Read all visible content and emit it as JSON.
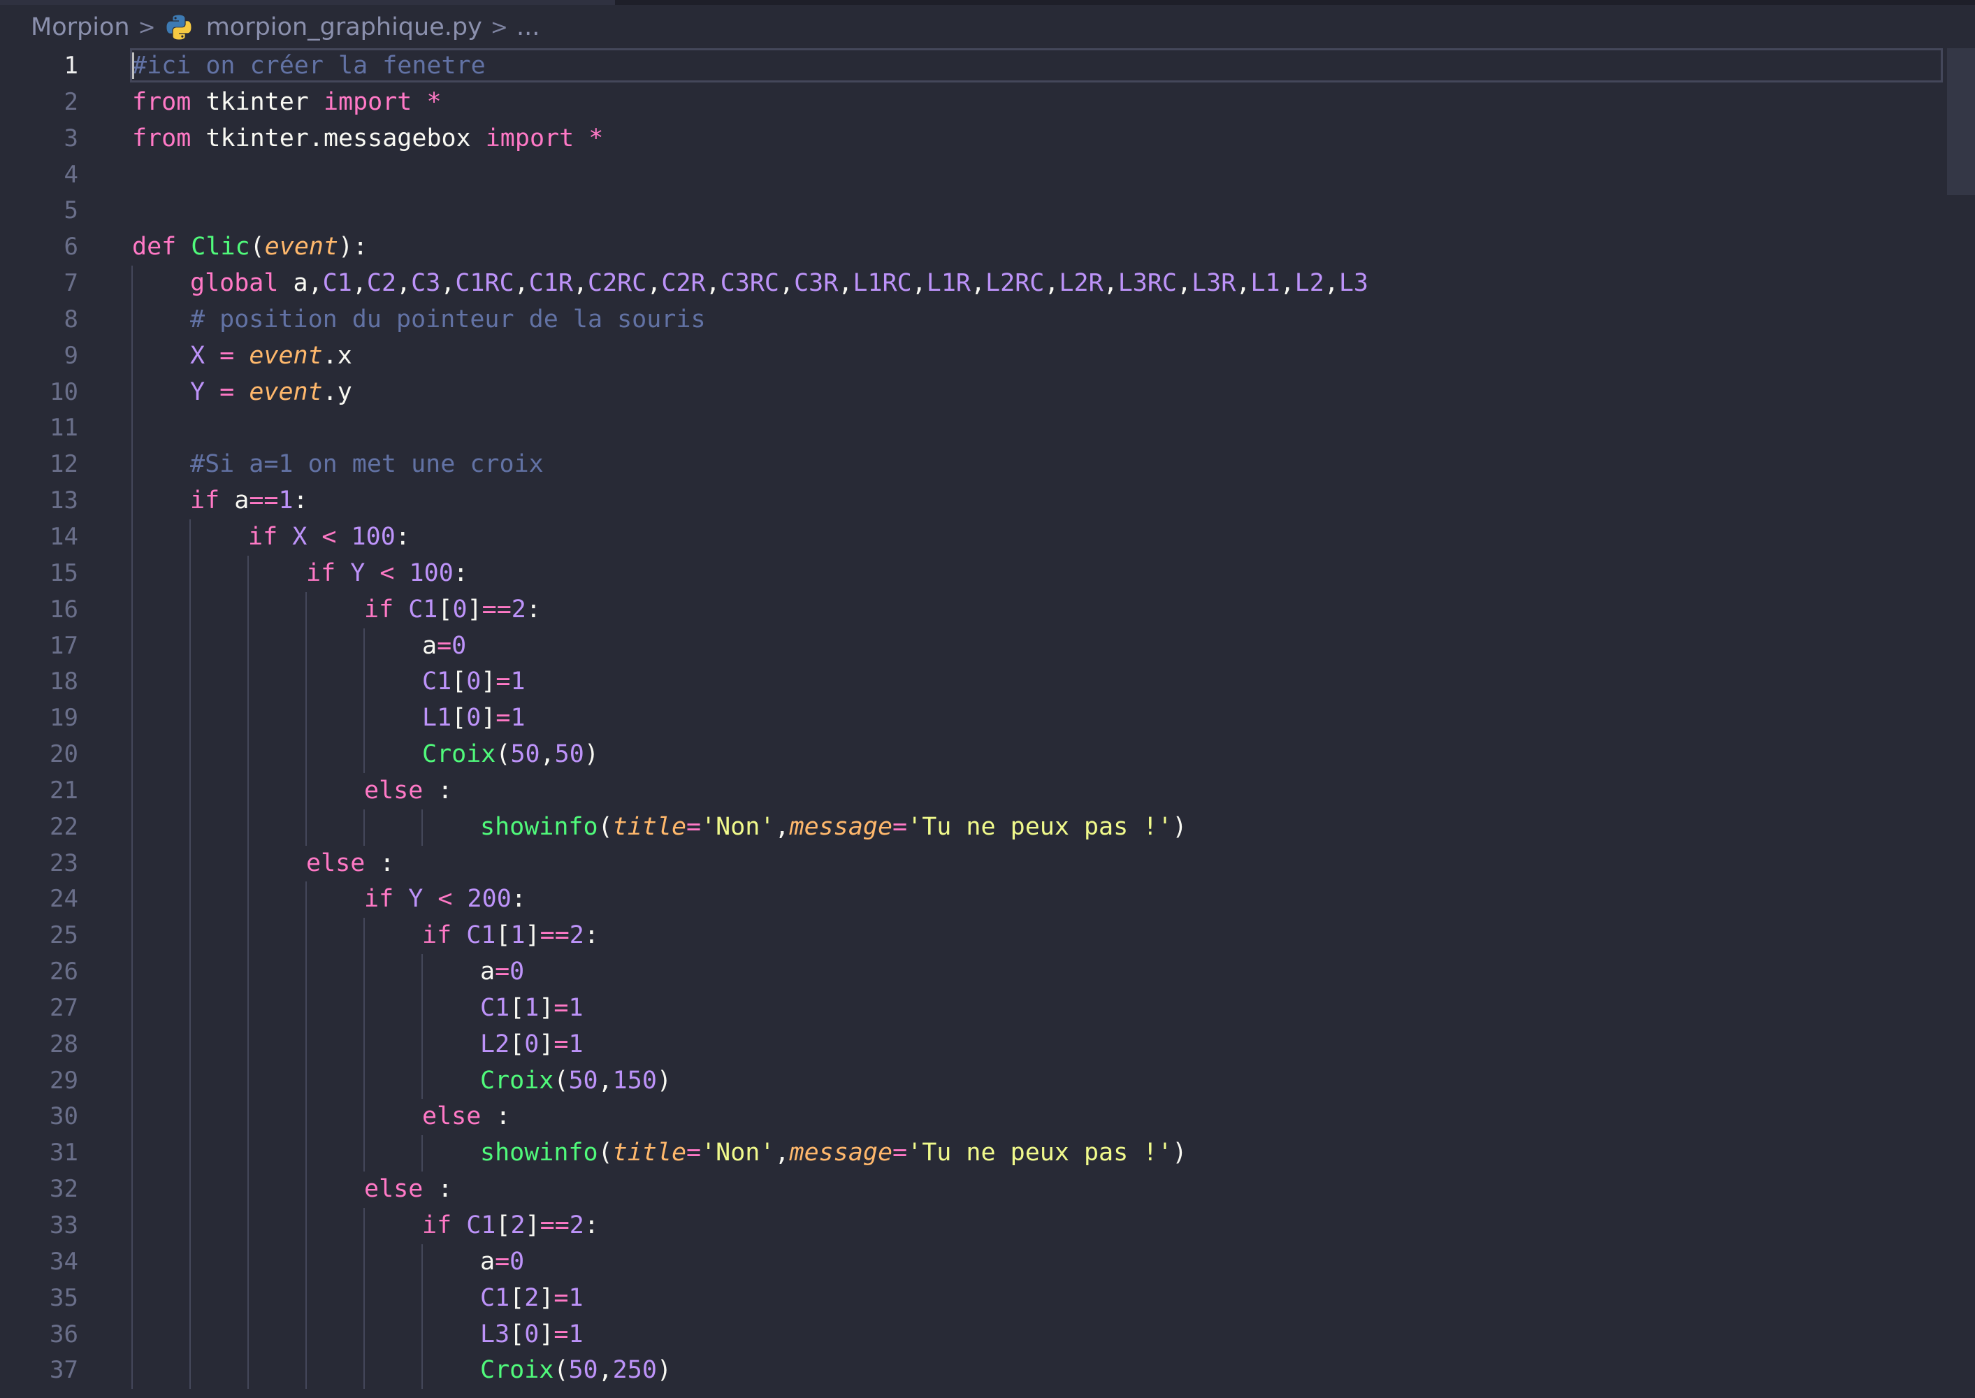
{
  "breadcrumb": {
    "folder": "Morpion",
    "separator": ">",
    "file": "morpion_graphique.py",
    "ellipsis": "...",
    "file_icon": "python-icon"
  },
  "editor": {
    "current_line": 1,
    "lines": [
      {
        "n": "1",
        "indent": 0,
        "tokens": [
          {
            "t": "#ici on créer la fenetre",
            "c": "cm"
          }
        ]
      },
      {
        "n": "2",
        "indent": 0,
        "tokens": [
          {
            "t": "from",
            "c": "kw"
          },
          {
            "t": " tkinter ",
            "c": "plain"
          },
          {
            "t": "import",
            "c": "kw"
          },
          {
            "t": " ",
            "c": "plain"
          },
          {
            "t": "*",
            "c": "op"
          }
        ]
      },
      {
        "n": "3",
        "indent": 0,
        "tokens": [
          {
            "t": "from",
            "c": "kw"
          },
          {
            "t": " tkinter.messagebox ",
            "c": "plain"
          },
          {
            "t": "import",
            "c": "kw"
          },
          {
            "t": " ",
            "c": "plain"
          },
          {
            "t": "*",
            "c": "op"
          }
        ]
      },
      {
        "n": "4",
        "indent": 0,
        "tokens": []
      },
      {
        "n": "5",
        "indent": 0,
        "tokens": []
      },
      {
        "n": "6",
        "indent": 0,
        "tokens": [
          {
            "t": "def",
            "c": "kw"
          },
          {
            "t": " ",
            "c": "plain"
          },
          {
            "t": "Clic",
            "c": "fn"
          },
          {
            "t": "(",
            "c": "plain"
          },
          {
            "t": "event",
            "c": "param"
          },
          {
            "t": "):",
            "c": "plain"
          }
        ]
      },
      {
        "n": "7",
        "indent": 1,
        "tokens": [
          {
            "t": "global",
            "c": "kw"
          },
          {
            "t": " a,",
            "c": "plain"
          },
          {
            "t": "C1",
            "c": "const"
          },
          {
            "t": ",",
            "c": "plain"
          },
          {
            "t": "C2",
            "c": "const"
          },
          {
            "t": ",",
            "c": "plain"
          },
          {
            "t": "C3",
            "c": "const"
          },
          {
            "t": ",",
            "c": "plain"
          },
          {
            "t": "C1RC",
            "c": "const"
          },
          {
            "t": ",",
            "c": "plain"
          },
          {
            "t": "C1R",
            "c": "const"
          },
          {
            "t": ",",
            "c": "plain"
          },
          {
            "t": "C2RC",
            "c": "const"
          },
          {
            "t": ",",
            "c": "plain"
          },
          {
            "t": "C2R",
            "c": "const"
          },
          {
            "t": ",",
            "c": "plain"
          },
          {
            "t": "C3RC",
            "c": "const"
          },
          {
            "t": ",",
            "c": "plain"
          },
          {
            "t": "C3R",
            "c": "const"
          },
          {
            "t": ",",
            "c": "plain"
          },
          {
            "t": "L1RC",
            "c": "const"
          },
          {
            "t": ",",
            "c": "plain"
          },
          {
            "t": "L1R",
            "c": "const"
          },
          {
            "t": ",",
            "c": "plain"
          },
          {
            "t": "L2RC",
            "c": "const"
          },
          {
            "t": ",",
            "c": "plain"
          },
          {
            "t": "L2R",
            "c": "const"
          },
          {
            "t": ",",
            "c": "plain"
          },
          {
            "t": "L3RC",
            "c": "const"
          },
          {
            "t": ",",
            "c": "plain"
          },
          {
            "t": "L3R",
            "c": "const"
          },
          {
            "t": ",",
            "c": "plain"
          },
          {
            "t": "L1",
            "c": "const"
          },
          {
            "t": ",",
            "c": "plain"
          },
          {
            "t": "L2",
            "c": "const"
          },
          {
            "t": ",",
            "c": "plain"
          },
          {
            "t": "L3",
            "c": "const"
          }
        ]
      },
      {
        "n": "8",
        "indent": 1,
        "tokens": [
          {
            "t": "# position du pointeur de la souris",
            "c": "cm"
          }
        ]
      },
      {
        "n": "9",
        "indent": 1,
        "tokens": [
          {
            "t": "X",
            "c": "const"
          },
          {
            "t": " ",
            "c": "plain"
          },
          {
            "t": "=",
            "c": "op"
          },
          {
            "t": " ",
            "c": "plain"
          },
          {
            "t": "event",
            "c": "param"
          },
          {
            "t": ".x",
            "c": "plain"
          }
        ]
      },
      {
        "n": "10",
        "indent": 1,
        "tokens": [
          {
            "t": "Y",
            "c": "const"
          },
          {
            "t": " ",
            "c": "plain"
          },
          {
            "t": "=",
            "c": "op"
          },
          {
            "t": " ",
            "c": "plain"
          },
          {
            "t": "event",
            "c": "param"
          },
          {
            "t": ".y",
            "c": "plain"
          }
        ]
      },
      {
        "n": "11",
        "indent": 1,
        "tokens": []
      },
      {
        "n": "12",
        "indent": 1,
        "tokens": [
          {
            "t": "#Si a=1 on met une croix",
            "c": "cm"
          }
        ]
      },
      {
        "n": "13",
        "indent": 1,
        "tokens": [
          {
            "t": "if",
            "c": "kw"
          },
          {
            "t": " a",
            "c": "plain"
          },
          {
            "t": "==",
            "c": "op"
          },
          {
            "t": "1",
            "c": "num"
          },
          {
            "t": ":",
            "c": "plain"
          }
        ]
      },
      {
        "n": "14",
        "indent": 2,
        "tokens": [
          {
            "t": "if",
            "c": "kw"
          },
          {
            "t": " ",
            "c": "plain"
          },
          {
            "t": "X",
            "c": "const"
          },
          {
            "t": " ",
            "c": "plain"
          },
          {
            "t": "<",
            "c": "op"
          },
          {
            "t": " ",
            "c": "plain"
          },
          {
            "t": "100",
            "c": "num"
          },
          {
            "t": ":",
            "c": "plain"
          }
        ]
      },
      {
        "n": "15",
        "indent": 3,
        "tokens": [
          {
            "t": "if",
            "c": "kw"
          },
          {
            "t": " ",
            "c": "plain"
          },
          {
            "t": "Y",
            "c": "const"
          },
          {
            "t": " ",
            "c": "plain"
          },
          {
            "t": "<",
            "c": "op"
          },
          {
            "t": " ",
            "c": "plain"
          },
          {
            "t": "100",
            "c": "num"
          },
          {
            "t": ":",
            "c": "plain"
          }
        ]
      },
      {
        "n": "16",
        "indent": 4,
        "tokens": [
          {
            "t": "if",
            "c": "kw"
          },
          {
            "t": " ",
            "c": "plain"
          },
          {
            "t": "C1",
            "c": "const"
          },
          {
            "t": "[",
            "c": "plain"
          },
          {
            "t": "0",
            "c": "num"
          },
          {
            "t": "]",
            "c": "plain"
          },
          {
            "t": "==",
            "c": "op"
          },
          {
            "t": "2",
            "c": "num"
          },
          {
            "t": ":",
            "c": "plain"
          }
        ]
      },
      {
        "n": "17",
        "indent": 5,
        "tokens": [
          {
            "t": "a",
            "c": "plain"
          },
          {
            "t": "=",
            "c": "op"
          },
          {
            "t": "0",
            "c": "num"
          }
        ]
      },
      {
        "n": "18",
        "indent": 5,
        "tokens": [
          {
            "t": "C1",
            "c": "const"
          },
          {
            "t": "[",
            "c": "plain"
          },
          {
            "t": "0",
            "c": "num"
          },
          {
            "t": "]",
            "c": "plain"
          },
          {
            "t": "=",
            "c": "op"
          },
          {
            "t": "1",
            "c": "num"
          }
        ]
      },
      {
        "n": "19",
        "indent": 5,
        "tokens": [
          {
            "t": "L1",
            "c": "const"
          },
          {
            "t": "[",
            "c": "plain"
          },
          {
            "t": "0",
            "c": "num"
          },
          {
            "t": "]",
            "c": "plain"
          },
          {
            "t": "=",
            "c": "op"
          },
          {
            "t": "1",
            "c": "num"
          }
        ]
      },
      {
        "n": "20",
        "indent": 5,
        "tokens": [
          {
            "t": "Croix",
            "c": "fn"
          },
          {
            "t": "(",
            "c": "plain"
          },
          {
            "t": "50",
            "c": "num"
          },
          {
            "t": ",",
            "c": "plain"
          },
          {
            "t": "50",
            "c": "num"
          },
          {
            "t": ")",
            "c": "plain"
          }
        ]
      },
      {
        "n": "21",
        "indent": 4,
        "tokens": [
          {
            "t": "else",
            "c": "kw"
          },
          {
            "t": " :",
            "c": "plain"
          }
        ]
      },
      {
        "n": "22",
        "indent": 6,
        "tokens": [
          {
            "t": "showinfo",
            "c": "fn"
          },
          {
            "t": "(",
            "c": "plain"
          },
          {
            "t": "title",
            "c": "param"
          },
          {
            "t": "=",
            "c": "op"
          },
          {
            "t": "'Non'",
            "c": "str"
          },
          {
            "t": ",",
            "c": "plain"
          },
          {
            "t": "message",
            "c": "param"
          },
          {
            "t": "=",
            "c": "op"
          },
          {
            "t": "'Tu ne peux pas !'",
            "c": "str"
          },
          {
            "t": ")",
            "c": "plain"
          }
        ]
      },
      {
        "n": "23",
        "indent": 3,
        "tokens": [
          {
            "t": "else",
            "c": "kw"
          },
          {
            "t": " :",
            "c": "plain"
          }
        ]
      },
      {
        "n": "24",
        "indent": 4,
        "tokens": [
          {
            "t": "if",
            "c": "kw"
          },
          {
            "t": " ",
            "c": "plain"
          },
          {
            "t": "Y",
            "c": "const"
          },
          {
            "t": " ",
            "c": "plain"
          },
          {
            "t": "<",
            "c": "op"
          },
          {
            "t": " ",
            "c": "plain"
          },
          {
            "t": "200",
            "c": "num"
          },
          {
            "t": ":",
            "c": "plain"
          }
        ]
      },
      {
        "n": "25",
        "indent": 5,
        "tokens": [
          {
            "t": "if",
            "c": "kw"
          },
          {
            "t": " ",
            "c": "plain"
          },
          {
            "t": "C1",
            "c": "const"
          },
          {
            "t": "[",
            "c": "plain"
          },
          {
            "t": "1",
            "c": "num"
          },
          {
            "t": "]",
            "c": "plain"
          },
          {
            "t": "==",
            "c": "op"
          },
          {
            "t": "2",
            "c": "num"
          },
          {
            "t": ":",
            "c": "plain"
          }
        ]
      },
      {
        "n": "26",
        "indent": 6,
        "tokens": [
          {
            "t": "a",
            "c": "plain"
          },
          {
            "t": "=",
            "c": "op"
          },
          {
            "t": "0",
            "c": "num"
          }
        ]
      },
      {
        "n": "27",
        "indent": 6,
        "tokens": [
          {
            "t": "C1",
            "c": "const"
          },
          {
            "t": "[",
            "c": "plain"
          },
          {
            "t": "1",
            "c": "num"
          },
          {
            "t": "]",
            "c": "plain"
          },
          {
            "t": "=",
            "c": "op"
          },
          {
            "t": "1",
            "c": "num"
          }
        ]
      },
      {
        "n": "28",
        "indent": 6,
        "tokens": [
          {
            "t": "L2",
            "c": "const"
          },
          {
            "t": "[",
            "c": "plain"
          },
          {
            "t": "0",
            "c": "num"
          },
          {
            "t": "]",
            "c": "plain"
          },
          {
            "t": "=",
            "c": "op"
          },
          {
            "t": "1",
            "c": "num"
          }
        ]
      },
      {
        "n": "29",
        "indent": 6,
        "tokens": [
          {
            "t": "Croix",
            "c": "fn"
          },
          {
            "t": "(",
            "c": "plain"
          },
          {
            "t": "50",
            "c": "num"
          },
          {
            "t": ",",
            "c": "plain"
          },
          {
            "t": "150",
            "c": "num"
          },
          {
            "t": ")",
            "c": "plain"
          }
        ]
      },
      {
        "n": "30",
        "indent": 5,
        "tokens": [
          {
            "t": "else",
            "c": "kw"
          },
          {
            "t": " :",
            "c": "plain"
          }
        ]
      },
      {
        "n": "31",
        "indent": 6,
        "tokens": [
          {
            "t": "showinfo",
            "c": "fn"
          },
          {
            "t": "(",
            "c": "plain"
          },
          {
            "t": "title",
            "c": "param"
          },
          {
            "t": "=",
            "c": "op"
          },
          {
            "t": "'Non'",
            "c": "str"
          },
          {
            "t": ",",
            "c": "plain"
          },
          {
            "t": "message",
            "c": "param"
          },
          {
            "t": "=",
            "c": "op"
          },
          {
            "t": "'Tu ne peux pas !'",
            "c": "str"
          },
          {
            "t": ")",
            "c": "plain"
          }
        ]
      },
      {
        "n": "32",
        "indent": 4,
        "tokens": [
          {
            "t": "else",
            "c": "kw"
          },
          {
            "t": " :",
            "c": "plain"
          }
        ]
      },
      {
        "n": "33",
        "indent": 5,
        "tokens": [
          {
            "t": "if",
            "c": "kw"
          },
          {
            "t": " ",
            "c": "plain"
          },
          {
            "t": "C1",
            "c": "const"
          },
          {
            "t": "[",
            "c": "plain"
          },
          {
            "t": "2",
            "c": "num"
          },
          {
            "t": "]",
            "c": "plain"
          },
          {
            "t": "==",
            "c": "op"
          },
          {
            "t": "2",
            "c": "num"
          },
          {
            "t": ":",
            "c": "plain"
          }
        ]
      },
      {
        "n": "34",
        "indent": 6,
        "tokens": [
          {
            "t": "a",
            "c": "plain"
          },
          {
            "t": "=",
            "c": "op"
          },
          {
            "t": "0",
            "c": "num"
          }
        ]
      },
      {
        "n": "35",
        "indent": 6,
        "tokens": [
          {
            "t": "C1",
            "c": "const"
          },
          {
            "t": "[",
            "c": "plain"
          },
          {
            "t": "2",
            "c": "num"
          },
          {
            "t": "]",
            "c": "plain"
          },
          {
            "t": "=",
            "c": "op"
          },
          {
            "t": "1",
            "c": "num"
          }
        ]
      },
      {
        "n": "36",
        "indent": 6,
        "tokens": [
          {
            "t": "L3",
            "c": "const"
          },
          {
            "t": "[",
            "c": "plain"
          },
          {
            "t": "0",
            "c": "num"
          },
          {
            "t": "]",
            "c": "plain"
          },
          {
            "t": "=",
            "c": "op"
          },
          {
            "t": "1",
            "c": "num"
          }
        ]
      },
      {
        "n": "37",
        "indent": 6,
        "tokens": [
          {
            "t": "Croix",
            "c": "fn"
          },
          {
            "t": "(",
            "c": "plain"
          },
          {
            "t": "50",
            "c": "num"
          },
          {
            "t": ",",
            "c": "plain"
          },
          {
            "t": "250",
            "c": "num"
          },
          {
            "t": ")",
            "c": "plain"
          }
        ]
      }
    ]
  }
}
